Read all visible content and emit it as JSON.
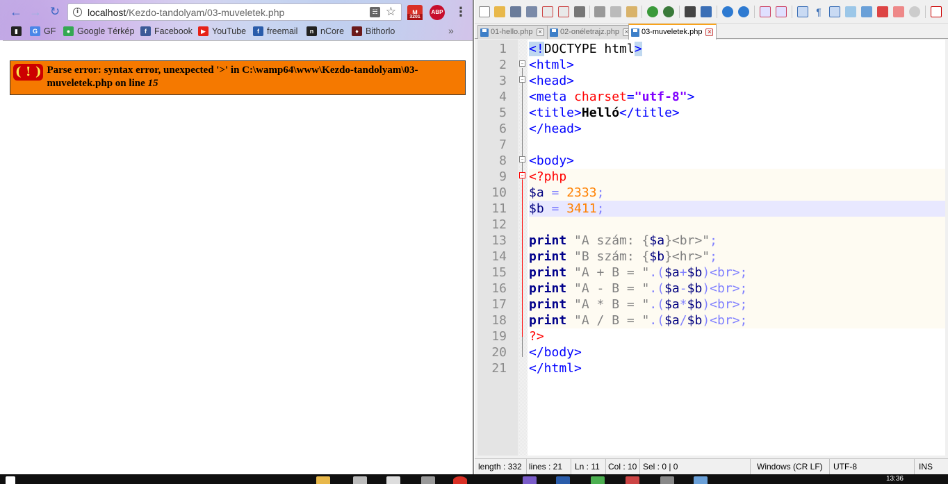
{
  "browser": {
    "url_host": "localhost",
    "url_path": "/Kezdo-tandolyam/03-muveletek.php",
    "gmail_count": "3201",
    "abp_label": "ABP",
    "bookmarks": [
      {
        "label": "",
        "icon": "bookmark-dark-icon",
        "color": "#222222"
      },
      {
        "label": "GF",
        "icon": "google-docs-icon",
        "color": "#4a86e8"
      },
      {
        "label": "Google Térkép",
        "icon": "google-maps-icon",
        "color": "#34a853"
      },
      {
        "label": "Facebook",
        "icon": "facebook-icon",
        "color": "#3b5998"
      },
      {
        "label": "YouTube",
        "icon": "youtube-icon",
        "color": "#e62117"
      },
      {
        "label": "freemail",
        "icon": "freemail-icon",
        "color": "#2a5caa"
      },
      {
        "label": "nCore",
        "icon": "ncore-icon",
        "color": "#222222"
      },
      {
        "label": "Bithorlo",
        "icon": "bithorlo-icon",
        "color": "#6b1a1a"
      }
    ],
    "error": {
      "badge": "( ! )",
      "message": "Parse error: syntax error, unexpected '>' in C:\\wamp64\\www\\Kezdo-tandolyam\\03-muveletek.php on line ",
      "line_no": "15"
    }
  },
  "npp": {
    "tabs": [
      {
        "label": "01-hello.php",
        "active": false
      },
      {
        "label": "02-onéletrajz.php",
        "active": false
      },
      {
        "label": "03-muveletek.php",
        "active": true
      }
    ],
    "line_numbers": [
      "1",
      "2",
      "3",
      "4",
      "5",
      "6",
      "7",
      "8",
      "9",
      "10",
      "11",
      "12",
      "13",
      "14",
      "15",
      "16",
      "17",
      "18",
      "19",
      "20",
      "21"
    ],
    "status": {
      "length": "length : 332",
      "lines": "lines : 21",
      "ln": "Ln : 11",
      "col": "Col : 10",
      "sel": "Sel : 0 | 0",
      "eol": "Windows (CR LF)",
      "encoding": "UTF-8",
      "mode": "INS"
    }
  },
  "code": {
    "l1": {
      "a": "<!",
      "b": "DOCTYPE html",
      "c": ">"
    },
    "l2": "<html>",
    "l3": "<head>",
    "l4": {
      "a": "<meta ",
      "b": "charset",
      "c": "=",
      "d": "\"utf-8\"",
      "e": ">"
    },
    "l5": {
      "a": "<title>",
      "b": "Helló",
      "c": "</title>"
    },
    "l6": "</head>",
    "l8": "<body>",
    "l9": "<?php",
    "l10": {
      "var": "$a",
      "op": " = ",
      "num": "2333",
      "end": ";"
    },
    "l11": {
      "var": "$b",
      "op": " = ",
      "num": "3411",
      "end": ";"
    },
    "l13": {
      "kw": "print",
      "s1": " \"A szám: {",
      "v": "$a",
      "s2": "}<br>\"",
      "end": ";"
    },
    "l14": {
      "kw": "print",
      "s1": " \"B szám: {",
      "v": "$b",
      "s2": "}<hr>\"",
      "end": ";"
    },
    "l15": {
      "kw": "print",
      "s1": " \"A + B = \"",
      "op1": ".(",
      "v1": "$a",
      "op2": "+",
      "v2": "$b",
      "op3": ")<br>;"
    },
    "l16": {
      "kw": "print",
      "s1": " \"A - B = \"",
      "op1": ".(",
      "v1": "$a",
      "op2": "-",
      "v2": "$b",
      "op3": ")<br>;"
    },
    "l17": {
      "kw": "print",
      "s1": " \"A * B = \"",
      "op1": ".(",
      "v1": "$a",
      "op2": "*",
      "v2": "$b",
      "op3": ")<br>;"
    },
    "l18": {
      "kw": "print",
      "s1": " \"A / B = \"",
      "op1": ".(",
      "v1": "$a",
      "op2": "/",
      "v2": "$b",
      "op3": ")<br>;"
    },
    "l19": "?>",
    "l20": "</body>",
    "l21": "</html>"
  },
  "taskbar": {
    "clock": "13:36"
  }
}
